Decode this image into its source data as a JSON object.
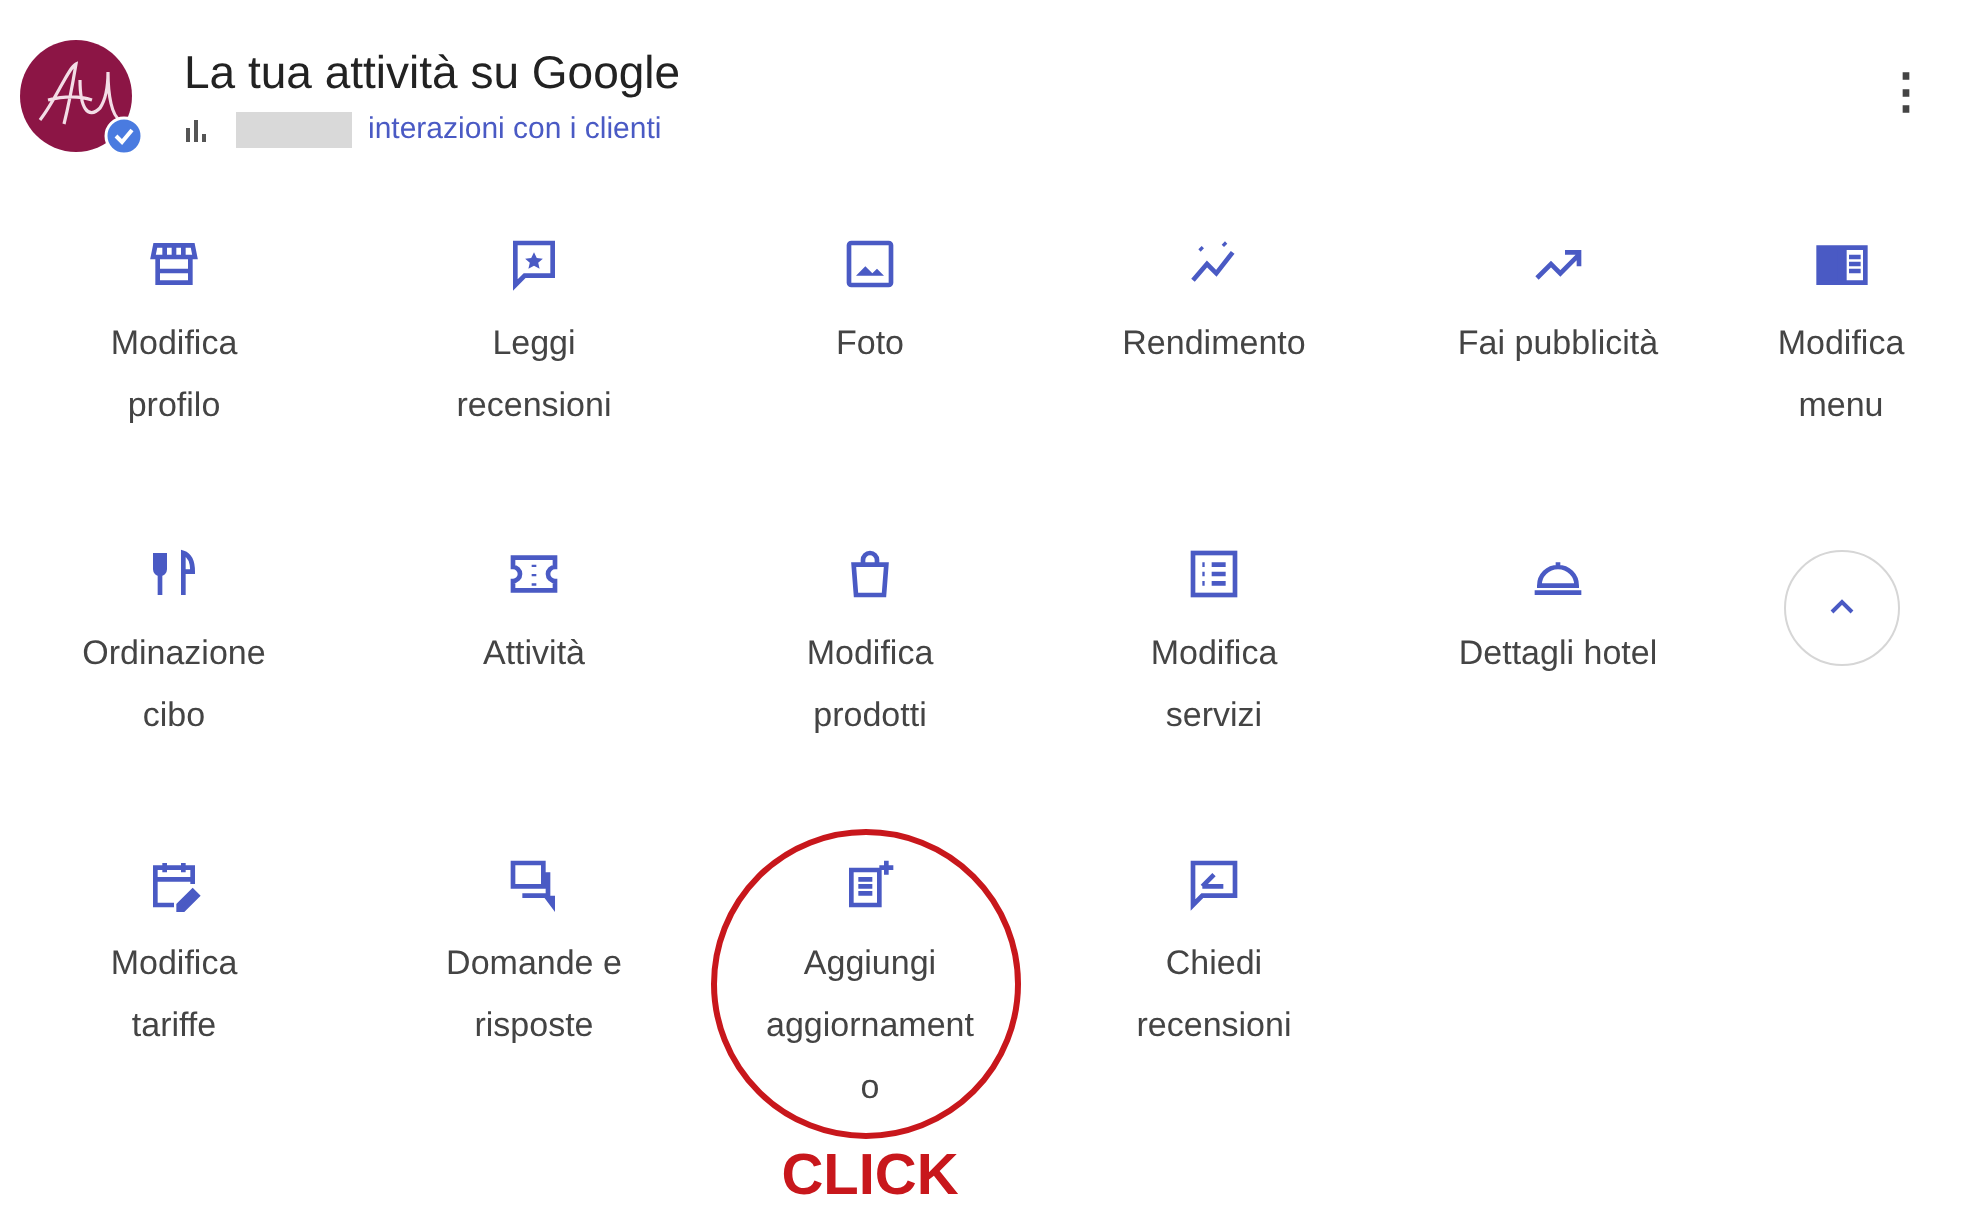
{
  "header": {
    "title": "La tua attività su Google",
    "verified": true,
    "stats_link": "interazioni con i clienti"
  },
  "menu_button": {
    "label": "⋮"
  },
  "actions": [
    {
      "kind": "action",
      "label": "Modifica profilo"
    },
    {
      "kind": "action",
      "label": "Leggi recensioni"
    },
    {
      "kind": "action",
      "label": "Foto"
    },
    {
      "kind": "action",
      "label": "Rendimento"
    },
    {
      "kind": "action",
      "label": "Fai pubblicità"
    },
    {
      "kind": "action",
      "label": "Modifica menu"
    },
    {
      "kind": "action",
      "label": "Ordinazione cibo"
    },
    {
      "kind": "action",
      "label": "Attività"
    },
    {
      "kind": "action",
      "label": "Modifica prodotti"
    },
    {
      "kind": "action",
      "label": "Modifica servizi"
    },
    {
      "kind": "action",
      "label": "Dettagli hotel"
    },
    {
      "kind": "toggle",
      "expanded": true
    },
    {
      "kind": "action",
      "label": "Modifica tariffe"
    },
    {
      "kind": "action",
      "label": "Domande e risposte"
    },
    {
      "kind": "action",
      "label": "Aggiungi aggiornamento",
      "annotation": {
        "label": "CLICK"
      }
    },
    {
      "kind": "action",
      "label": "Chiedi recensioni"
    }
  ]
}
